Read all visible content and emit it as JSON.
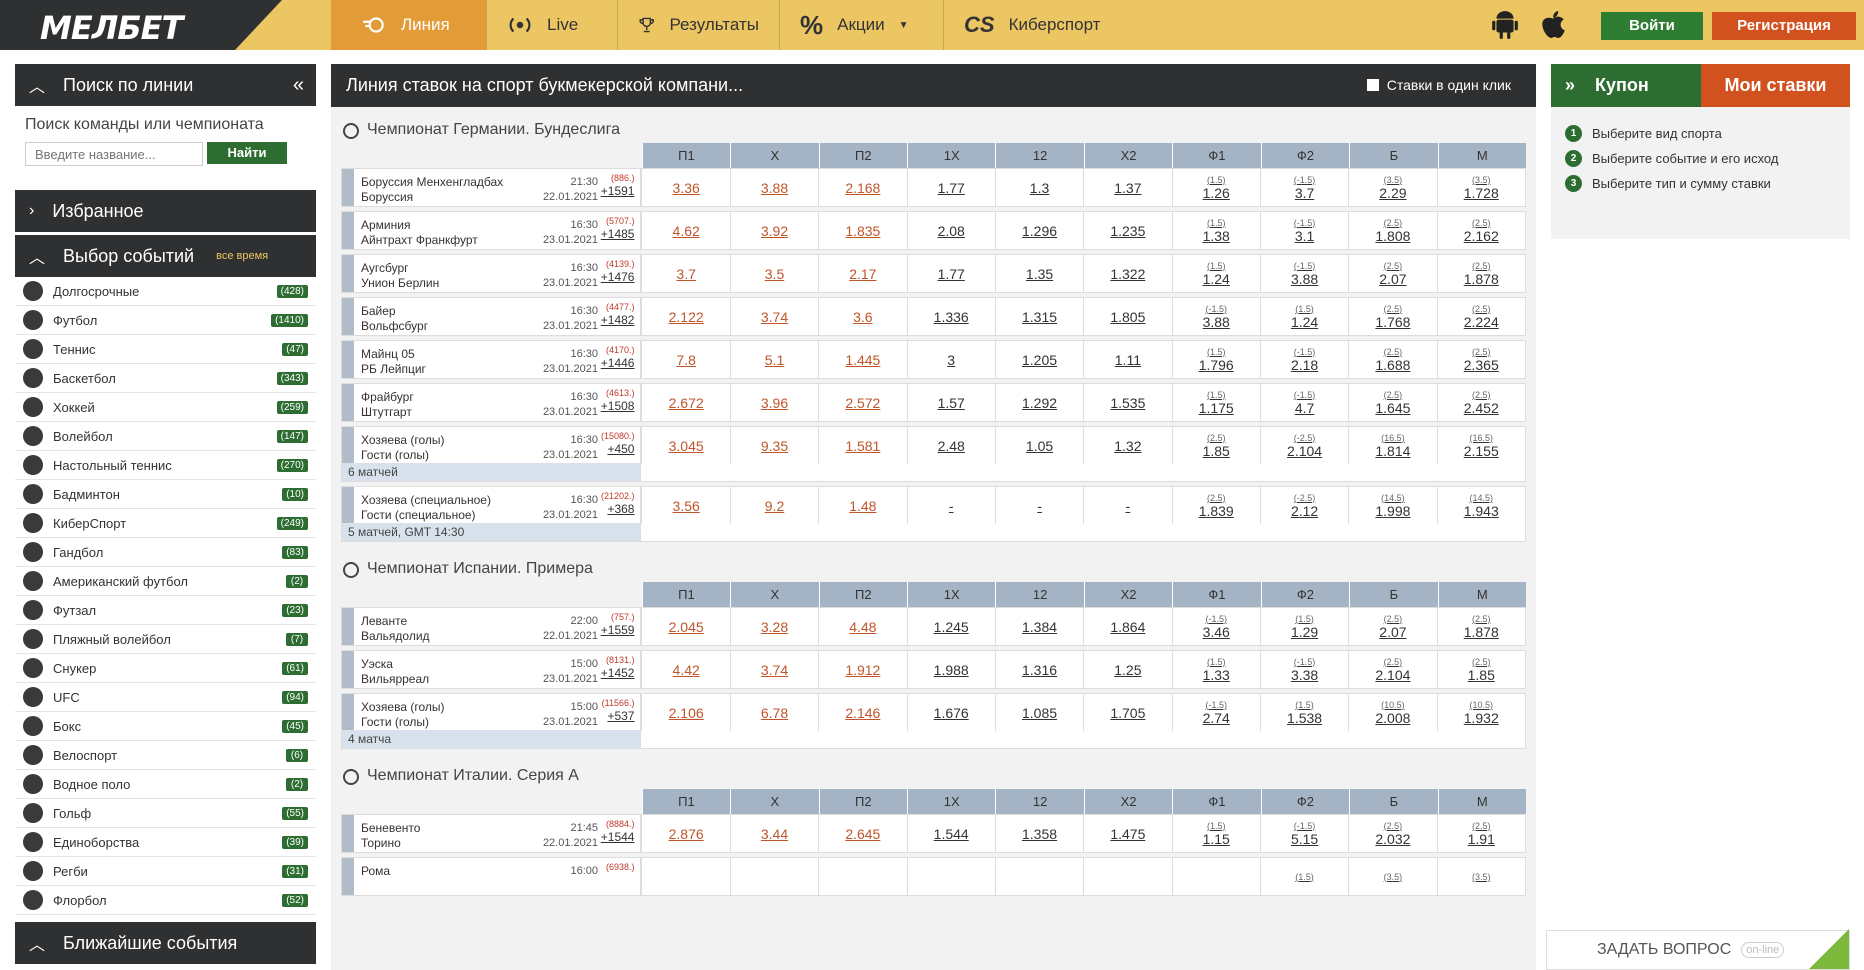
{
  "header": {
    "logo": "МЕЛБЕТ",
    "nav": [
      {
        "label": "Линия",
        "icon": "line-icon"
      },
      {
        "label": "Live",
        "icon": "live-icon"
      },
      {
        "label": "Результаты",
        "icon": "trophy-icon"
      },
      {
        "label": "Акции",
        "icon": "percent-icon"
      },
      {
        "label": "Киберспорт",
        "icon": "cs-icon"
      }
    ],
    "login": "Войти",
    "register": "Регистрация"
  },
  "left": {
    "search_title": "Поиск по линии",
    "search_label": "Поиск команды или чемпионата",
    "search_placeholder": "Введите название...",
    "search_button": "Найти",
    "favorites": "Избранное",
    "events_title": "Выбор событий",
    "events_filter": "все время",
    "sports": [
      {
        "name": "Долгосрочные",
        "count": "428"
      },
      {
        "name": "Футбол",
        "count": "1410"
      },
      {
        "name": "Теннис",
        "count": "47"
      },
      {
        "name": "Баскетбол",
        "count": "343"
      },
      {
        "name": "Хоккей",
        "count": "259"
      },
      {
        "name": "Волейбол",
        "count": "147"
      },
      {
        "name": "Настольный теннис",
        "count": "270"
      },
      {
        "name": "Бадминтон",
        "count": "10"
      },
      {
        "name": "КиберСпорт",
        "count": "249"
      },
      {
        "name": "Гандбол",
        "count": "83"
      },
      {
        "name": "Американский футбол",
        "count": "2"
      },
      {
        "name": "Футзал",
        "count": "23"
      },
      {
        "name": "Пляжный волейбол",
        "count": "7"
      },
      {
        "name": "Снукер",
        "count": "61"
      },
      {
        "name": "UFC",
        "count": "94"
      },
      {
        "name": "Бокс",
        "count": "45"
      },
      {
        "name": "Велоспорт",
        "count": "6"
      },
      {
        "name": "Водное поло",
        "count": "2"
      },
      {
        "name": "Гольф",
        "count": "55"
      },
      {
        "name": "Единоборства",
        "count": "39"
      },
      {
        "name": "Регби",
        "count": "31"
      },
      {
        "name": "Флорбол",
        "count": "52"
      }
    ],
    "nearest": "Ближайшие события"
  },
  "center": {
    "title": "Линия ставок на спорт букмекерской компани...",
    "one_click": "Ставки в один клик",
    "columns": [
      "П1",
      "Х",
      "П2",
      "1Х",
      "12",
      "Х2",
      "Ф1",
      "Ф2",
      "Б",
      "М"
    ],
    "championships": [
      {
        "name": "Чемпионат Германии. Бундеслига",
        "events": [
          {
            "t1": "Боруссия Менхенгладбах",
            "t2": "Боруссия",
            "time": "21:30",
            "date": "22.01.2021",
            "a": "(886.)",
            "b": "+1591",
            "odds": [
              "3.36",
              "3.88",
              "2.168",
              "1.77",
              "1.3",
              "1.37",
              "1.26",
              "3.7",
              "2.29",
              "1.728"
            ],
            "subs": [
              "(1.5)",
              "(-1.5)",
              "(3.5)",
              "(3.5)"
            ],
            "foot": ""
          },
          {
            "t1": "Арминия",
            "t2": "Айнтрахт Франкфурт",
            "time": "16:30",
            "date": "23.01.2021",
            "a": "(5707.)",
            "b": "+1485",
            "odds": [
              "4.62",
              "3.92",
              "1.835",
              "2.08",
              "1.296",
              "1.235",
              "1.38",
              "3.1",
              "1.808",
              "2.162"
            ],
            "subs": [
              "(1.5)",
              "(-1.5)",
              "(2.5)",
              "(2.5)"
            ],
            "foot": ""
          },
          {
            "t1": "Аугсбург",
            "t2": "Унион Берлин",
            "time": "16:30",
            "date": "23.01.2021",
            "a": "(4139.)",
            "b": "+1476",
            "odds": [
              "3.7",
              "3.5",
              "2.17",
              "1.77",
              "1.35",
              "1.322",
              "1.24",
              "3.88",
              "2.07",
              "1.878"
            ],
            "subs": [
              "(1.5)",
              "(-1.5)",
              "(2.5)",
              "(2.5)"
            ],
            "foot": ""
          },
          {
            "t1": "Байер",
            "t2": "Вольфсбург",
            "time": "16:30",
            "date": "23.01.2021",
            "a": "(4477.)",
            "b": "+1482",
            "odds": [
              "2.122",
              "3.74",
              "3.6",
              "1.336",
              "1.315",
              "1.805",
              "3.88",
              "1.24",
              "1.768",
              "2.224"
            ],
            "subs": [
              "(-1.5)",
              "(1.5)",
              "(2.5)",
              "(2.5)"
            ],
            "foot": ""
          },
          {
            "t1": "Майнц 05",
            "t2": "РБ Лейпциг",
            "time": "16:30",
            "date": "23.01.2021",
            "a": "(4170.)",
            "b": "+1446",
            "odds": [
              "7.8",
              "5.1",
              "1.445",
              "3",
              "1.205",
              "1.11",
              "1.796",
              "2.18",
              "1.688",
              "2.365"
            ],
            "subs": [
              "(1.5)",
              "(-1.5)",
              "(2.5)",
              "(2.5)"
            ],
            "foot": ""
          },
          {
            "t1": "Фрайбург",
            "t2": "Штутгарт",
            "time": "16:30",
            "date": "23.01.2021",
            "a": "(4613.)",
            "b": "+1508",
            "odds": [
              "2.672",
              "3.96",
              "2.572",
              "1.57",
              "1.292",
              "1.535",
              "1.175",
              "4.7",
              "1.645",
              "2.452"
            ],
            "subs": [
              "(1.5)",
              "(-1.5)",
              "(2.5)",
              "(2.5)"
            ],
            "foot": ""
          },
          {
            "t1": "Хозяева (голы)",
            "t2": "Гости (голы)",
            "time": "16:30",
            "date": "23.01.2021",
            "a": "(15080.)",
            "b": "+450",
            "odds": [
              "3.045",
              "9.35",
              "1.581",
              "2.48",
              "1.05",
              "1.32",
              "1.85",
              "2.104",
              "1.814",
              "2.155"
            ],
            "subs": [
              "(2.5)",
              "(-2.5)",
              "(16.5)",
              "(16.5)"
            ],
            "foot": "6 матчей"
          },
          {
            "t1": "Хозяева (специальное)",
            "t2": "Гости (специальное)",
            "time": "16:30",
            "date": "23.01.2021",
            "a": "(21202.)",
            "b": "+368",
            "odds": [
              "3.56",
              "9.2",
              "1.48",
              "-",
              "-",
              "-",
              "1.839",
              "2.12",
              "1.998",
              "1.943"
            ],
            "subs": [
              "(2.5)",
              "(-2.5)",
              "(14.5)",
              "(14.5)"
            ],
            "foot": "5 матчей, GMT 14:30"
          }
        ]
      },
      {
        "name": "Чемпионат Испании. Примера",
        "events": [
          {
            "t1": "Леванте",
            "t2": "Вальядолид",
            "time": "22:00",
            "date": "22.01.2021",
            "a": "(757.)",
            "b": "+1559",
            "odds": [
              "2.045",
              "3.28",
              "4.48",
              "1.245",
              "1.384",
              "1.864",
              "3.46",
              "1.29",
              "2.07",
              "1.878"
            ],
            "subs": [
              "(-1.5)",
              "(1.5)",
              "(2.5)",
              "(2.5)"
            ],
            "foot": ""
          },
          {
            "t1": "Уэска",
            "t2": "Вильярреал",
            "time": "15:00",
            "date": "23.01.2021",
            "a": "(8131.)",
            "b": "+1452",
            "odds": [
              "4.42",
              "3.74",
              "1.912",
              "1.988",
              "1.316",
              "1.25",
              "1.33",
              "3.38",
              "2.104",
              "1.85"
            ],
            "subs": [
              "(1.5)",
              "(-1.5)",
              "(2.5)",
              "(2.5)"
            ],
            "foot": ""
          },
          {
            "t1": "Хозяева (голы)",
            "t2": "Гости (голы)",
            "time": "15:00",
            "date": "23.01.2021",
            "a": "(11566.)",
            "b": "+537",
            "odds": [
              "2.106",
              "6.78",
              "2.146",
              "1.676",
              "1.085",
              "1.705",
              "2.74",
              "1.538",
              "2.008",
              "1.932"
            ],
            "subs": [
              "(-1.5)",
              "(1.5)",
              "(10.5)",
              "(10.5)"
            ],
            "foot": "4 матча"
          }
        ]
      },
      {
        "name": "Чемпионат Италии. Серия А",
        "events": [
          {
            "t1": "Беневенто",
            "t2": "Торино",
            "time": "21:45",
            "date": "22.01.2021",
            "a": "(8884.)",
            "b": "+1544",
            "odds": [
              "2.876",
              "3.44",
              "2.645",
              "1.544",
              "1.358",
              "1.475",
              "1.15",
              "5.15",
              "2.032",
              "1.91"
            ],
            "subs": [
              "(1.5)",
              "(-1.5)",
              "(2.5)",
              "(2.5)"
            ],
            "foot": ""
          },
          {
            "t1": "Рома",
            "t2": "",
            "time": "16:00",
            "date": "",
            "a": "(6938.)",
            "b": "",
            "odds": [
              "",
              "",
              "",
              "",
              "",
              "",
              "",
              "",
              "",
              ""
            ],
            "subs": [
              "",
              "(1.5)",
              "(3.5)",
              "(3.5)"
            ],
            "foot": ""
          }
        ]
      }
    ]
  },
  "right": {
    "coupon": "Купон",
    "mybets": "Мои ставки",
    "steps": [
      "Выберите вид спорта",
      "Выберите событие и его исход",
      "Выберите тип и сумму ставки"
    ],
    "ask": "ЗАДАТЬ ВОПРОС",
    "online": "on-line"
  }
}
